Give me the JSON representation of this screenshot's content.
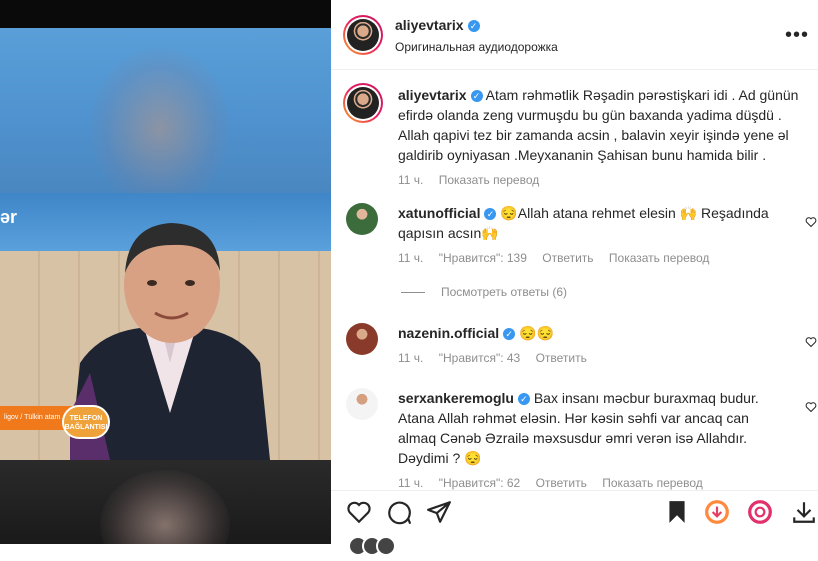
{
  "post": {
    "author": "aliyevtarix",
    "audio": "Оригинальная аудиодорожка",
    "caption": "Atam rəhmətlik Rəşadin pərəstişkari idi . Ad günün efirdə olanda zeng vurmuşdu bu gün baxanda yadima düşdü . Allah qapivi tez bir zamanda acsin , balavin xeyir işində yene əl galdirib oyniyasan .Meyxananin Şahisan bunu hamida bilir .",
    "caption_time": "11 ч.",
    "see_translation": "Показать перевод"
  },
  "media": {
    "band_text": "ər",
    "lower_third": "ligov  / Tülkin atam",
    "logo": "TELEFON BAĞLANTISI"
  },
  "comments": [
    {
      "user": "xatunofficial",
      "verified": true,
      "text": "😔Allah atana rehmet elesin 🙌 Reşadında qapısın acsın🙌",
      "time": "11 ч.",
      "likes": "\"Нравится\": 139",
      "reply": "Ответить",
      "translate": "Показать перевод"
    },
    {
      "user": "nazenin.official",
      "verified": true,
      "text": "😔😔",
      "time": "11 ч.",
      "likes": "\"Нравится\": 43",
      "reply": "Ответить"
    },
    {
      "user": "serxankeremoglu",
      "verified": true,
      "text": "Bax insanı məcbur buraxmaq budur. Atana Allah rəhmət eləsin. Hər kəsin səhfi var ancaq can almaq Cənəb Əzrailə məxsusdur əmri verən isə Allahdır. Dəydimi ? 😔",
      "time": "11 ч.",
      "likes": "\"Нравится\": 62",
      "reply": "Ответить",
      "translate": "Показать перевод"
    }
  ],
  "view_replies": "Посмотреть ответы (6)",
  "colors": {
    "verified": "#3897f0",
    "meta": "#8e8e8e",
    "text": "#262626"
  }
}
